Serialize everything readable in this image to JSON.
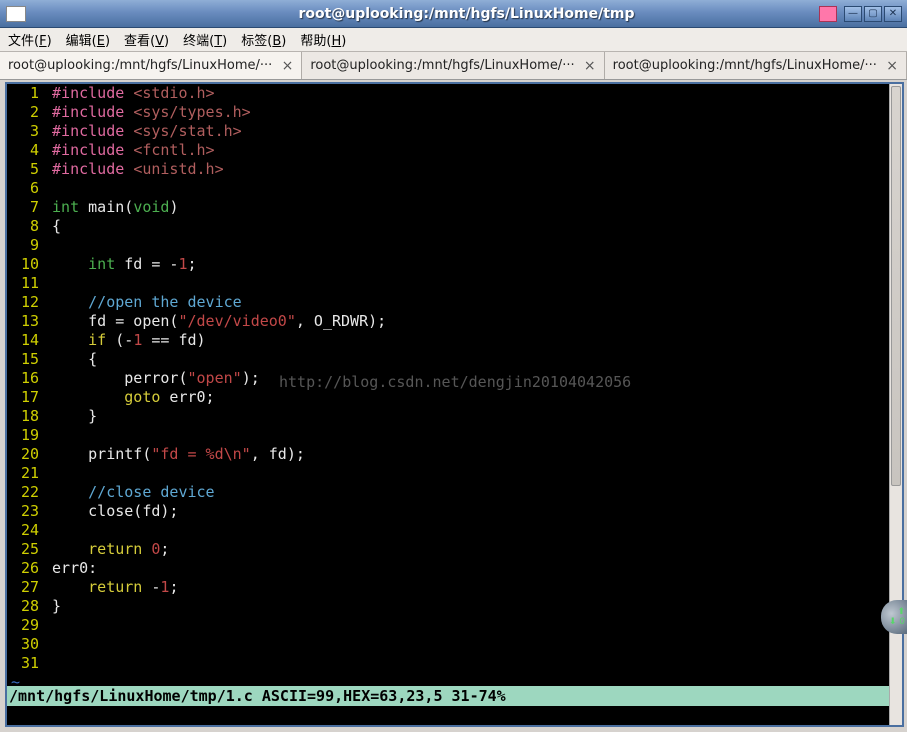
{
  "window": {
    "title": "root@uplooking:/mnt/hgfs/LinuxHome/tmp"
  },
  "menu": {
    "file": {
      "label": "文件",
      "accel": "F"
    },
    "edit": {
      "label": "编辑",
      "accel": "E"
    },
    "view": {
      "label": "查看",
      "accel": "V"
    },
    "term": {
      "label": "终端",
      "accel": "T"
    },
    "tags": {
      "label": "标签",
      "accel": "B"
    },
    "help": {
      "label": "帮助",
      "accel": "H"
    }
  },
  "tabs": [
    {
      "label": "root@uplooking:/mnt/hgfs/LinuxHome/···",
      "active": true
    },
    {
      "label": "root@uplooking:/mnt/hgfs/LinuxHome/···",
      "active": false
    },
    {
      "label": "root@uplooking:/mnt/hgfs/LinuxHome/···",
      "active": false
    }
  ],
  "code": {
    "lines": [
      {
        "n": 1,
        "segs": [
          [
            "pre",
            "#include "
          ],
          [
            "hdr",
            "<stdio.h>"
          ]
        ]
      },
      {
        "n": 2,
        "segs": [
          [
            "pre",
            "#include "
          ],
          [
            "hdr",
            "<sys/types.h>"
          ]
        ]
      },
      {
        "n": 3,
        "segs": [
          [
            "pre",
            "#include "
          ],
          [
            "hdr",
            "<sys/stat.h>"
          ]
        ]
      },
      {
        "n": 4,
        "segs": [
          [
            "pre",
            "#include "
          ],
          [
            "hdr",
            "<fcntl.h>"
          ]
        ]
      },
      {
        "n": 5,
        "segs": [
          [
            "pre",
            "#include "
          ],
          [
            "hdr",
            "<unistd.h>"
          ]
        ]
      },
      {
        "n": 6,
        "segs": []
      },
      {
        "n": 7,
        "segs": [
          [
            "type",
            "int"
          ],
          [
            "txt",
            " main("
          ],
          [
            "type",
            "void"
          ],
          [
            "txt",
            ")"
          ]
        ]
      },
      {
        "n": 8,
        "segs": [
          [
            "txt",
            "{"
          ]
        ]
      },
      {
        "n": 9,
        "segs": []
      },
      {
        "n": 10,
        "segs": [
          [
            "txt",
            "    "
          ],
          [
            "type",
            "int"
          ],
          [
            "txt",
            " fd = -"
          ],
          [
            "num",
            "1"
          ],
          [
            "txt",
            ";"
          ]
        ]
      },
      {
        "n": 11,
        "segs": []
      },
      {
        "n": 12,
        "segs": [
          [
            "txt",
            "    "
          ],
          [
            "cmt",
            "//open the device"
          ]
        ]
      },
      {
        "n": 13,
        "segs": [
          [
            "txt",
            "    fd = open("
          ],
          [
            "str",
            "\"/dev/video0\""
          ],
          [
            "txt",
            ", O_RDWR);"
          ]
        ]
      },
      {
        "n": 14,
        "segs": [
          [
            "txt",
            "    "
          ],
          [
            "kw",
            "if"
          ],
          [
            "txt",
            " (-"
          ],
          [
            "num",
            "1"
          ],
          [
            "txt",
            " == fd)"
          ]
        ]
      },
      {
        "n": 15,
        "segs": [
          [
            "txt",
            "    {"
          ]
        ]
      },
      {
        "n": 16,
        "segs": [
          [
            "txt",
            "        perror("
          ],
          [
            "str",
            "\"open\""
          ],
          [
            "txt",
            ");"
          ]
        ]
      },
      {
        "n": 17,
        "segs": [
          [
            "txt",
            "        "
          ],
          [
            "kw",
            "goto"
          ],
          [
            "txt",
            " err0;"
          ]
        ]
      },
      {
        "n": 18,
        "segs": [
          [
            "txt",
            "    }"
          ]
        ]
      },
      {
        "n": 19,
        "segs": []
      },
      {
        "n": 20,
        "segs": [
          [
            "txt",
            "    printf("
          ],
          [
            "str",
            "\"fd = %d\\n\""
          ],
          [
            "txt",
            ", fd);"
          ]
        ]
      },
      {
        "n": 21,
        "segs": []
      },
      {
        "n": 22,
        "segs": [
          [
            "txt",
            "    "
          ],
          [
            "cmt",
            "//close device"
          ]
        ]
      },
      {
        "n": 23,
        "segs": [
          [
            "txt",
            "    close(fd);"
          ]
        ]
      },
      {
        "n": 24,
        "segs": []
      },
      {
        "n": 25,
        "segs": [
          [
            "txt",
            "    "
          ],
          [
            "kw",
            "return"
          ],
          [
            "txt",
            " "
          ],
          [
            "num",
            "0"
          ],
          [
            "txt",
            ";"
          ]
        ]
      },
      {
        "n": 26,
        "segs": [
          [
            "txt",
            "err0:"
          ]
        ]
      },
      {
        "n": 27,
        "segs": [
          [
            "txt",
            "    "
          ],
          [
            "kw",
            "return"
          ],
          [
            "txt",
            " -"
          ],
          [
            "num",
            "1"
          ],
          [
            "txt",
            ";"
          ]
        ]
      },
      {
        "n": 28,
        "segs": [
          [
            "txt",
            "}"
          ]
        ]
      },
      {
        "n": 29,
        "segs": []
      },
      {
        "n": 30,
        "segs": []
      },
      {
        "n": 31,
        "segs": []
      }
    ],
    "tilde": "~"
  },
  "watermark": "http://blog.csdn.net/dengjin20104042056",
  "status": "/mnt/hgfs/LinuxHome/tmp/1.c ASCII=99,HEX=63,23,5 31-74%",
  "sidebadge": {
    "up": "⬆",
    "dn": "⬇ 0"
  }
}
